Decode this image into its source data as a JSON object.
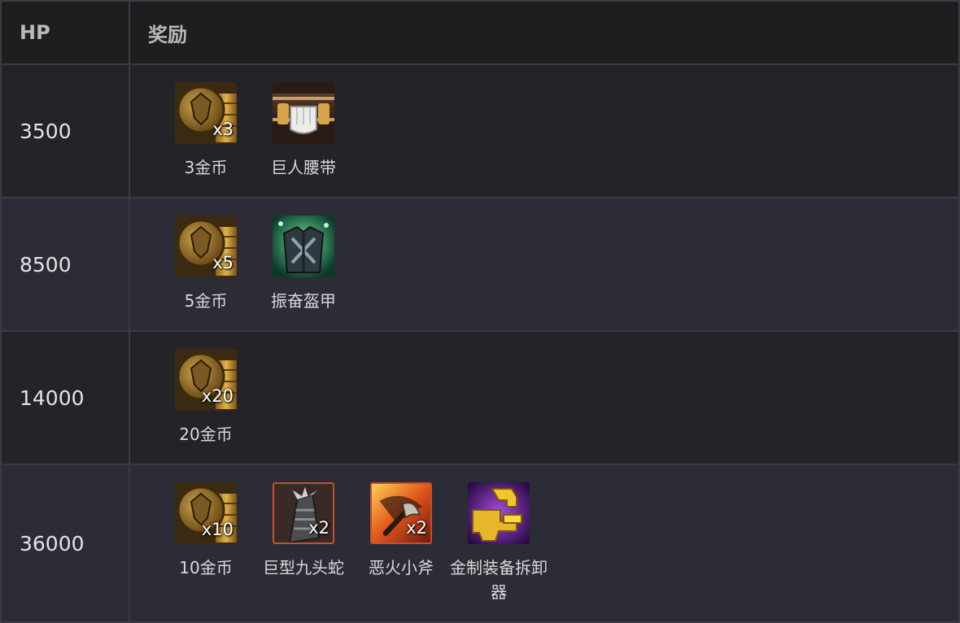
{
  "header": {
    "col_hp": "HP",
    "col_reward": "奖励"
  },
  "rows": [
    {
      "hp": "3500",
      "items": [
        {
          "icon": "gold-coin-icon",
          "qty": "x3",
          "label": "3金币"
        },
        {
          "icon": "giants-belt-icon",
          "qty": "",
          "label": "巨人腰带"
        }
      ]
    },
    {
      "hp": "8500",
      "items": [
        {
          "icon": "gold-coin-icon",
          "qty": "x5",
          "label": "5金币"
        },
        {
          "icon": "spirit-visage-armor-icon",
          "qty": "",
          "label": "振奋盔甲"
        }
      ]
    },
    {
      "hp": "14000",
      "items": [
        {
          "icon": "gold-coin-icon",
          "qty": "x20",
          "label": "20金币"
        }
      ]
    },
    {
      "hp": "36000",
      "items": [
        {
          "icon": "gold-coin-icon",
          "qty": "x10",
          "label": "10金币"
        },
        {
          "icon": "titanic-hydra-icon",
          "qty": "x2",
          "label": "巨型九头蛇"
        },
        {
          "icon": "hellfire-hatchet-icon",
          "qty": "x2",
          "label": "恶火小斧"
        },
        {
          "icon": "golden-disassembler-icon",
          "qty": "",
          "label": "金制装备拆卸器"
        }
      ]
    }
  ],
  "colors": {
    "background": "#1f1f23",
    "row_alt": "#2b2c35",
    "border": "#3b3b42",
    "accent_red": "#c4502e"
  }
}
